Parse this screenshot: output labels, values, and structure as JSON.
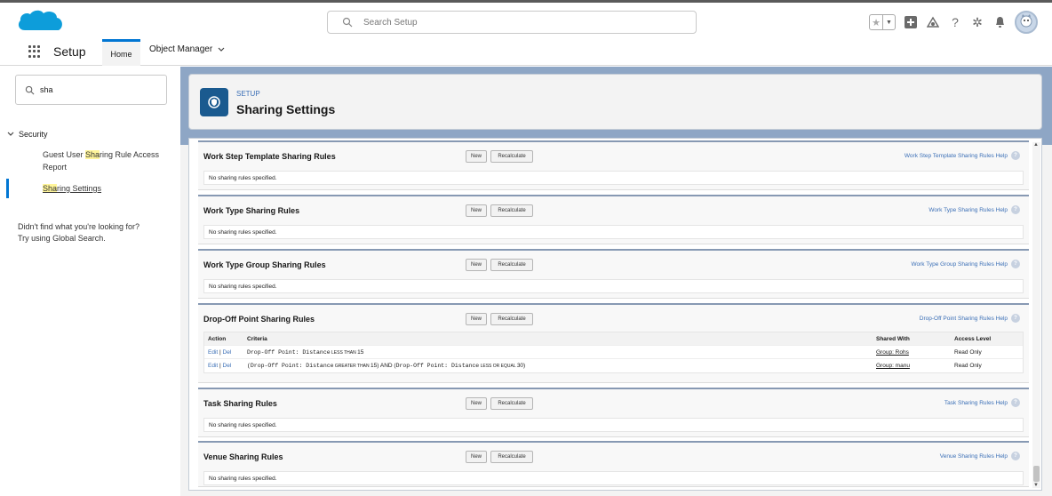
{
  "search": {
    "placeholder": "Search Setup"
  },
  "nav": {
    "app_name": "Setup",
    "tab_home": "Home",
    "tab_object_manager": "Object Manager"
  },
  "sidebar": {
    "quick_find_value": "sha",
    "section": "Security",
    "item1_pre": "Guest User ",
    "item1_hl": "Sha",
    "item1_post": "ring Rule Access Report",
    "item2_hl": "Sha",
    "item2_post": "ring Settings",
    "help_line1": "Didn't find what you're looking for?",
    "help_line2": "Try using Global Search."
  },
  "header": {
    "subtitle": "SETUP",
    "title": "Sharing Settings"
  },
  "buttons": {
    "new": "New",
    "recalculate": "Recalculate"
  },
  "empty_text": "No sharing rules specified.",
  "rules": [
    {
      "title": "Work Step Template Sharing Rules",
      "help": "Work Step Template Sharing Rules Help"
    },
    {
      "title": "Work Type Sharing Rules",
      "help": "Work Type Sharing Rules Help"
    },
    {
      "title": "Work Type Group Sharing Rules",
      "help": "Work Type Group Sharing Rules Help"
    },
    {
      "title": "Drop-Off Point Sharing Rules",
      "help": "Drop-Off Point Sharing Rules Help"
    },
    {
      "title": "Task Sharing Rules",
      "help": "Task Sharing Rules Help"
    },
    {
      "title": "Venue Sharing Rules",
      "help": "Venue Sharing Rules Help"
    }
  ],
  "dropoff_table": {
    "headers": {
      "action": "Action",
      "criteria": "Criteria",
      "shared_with": "Shared With",
      "access_level": "Access Level"
    },
    "rows": [
      {
        "edit": "Edit",
        "sep": " | ",
        "del": "Del",
        "criteria_parts": [
          "Drop-Off Point: Distance",
          " LESS THAN ",
          "15"
        ],
        "shared_with": "Group: Rohs",
        "access_level": "Read Only"
      },
      {
        "edit": "Edit",
        "sep": " | ",
        "del": "Del",
        "criteria_parts": [
          "(Drop-Off Point: Distance",
          " GREATER THAN ",
          "15) AND (",
          "Drop-Off Point: Distance",
          " LESS OR EQUAL ",
          "30)"
        ],
        "shared_with": "Group: manu",
        "access_level": "Read Only"
      }
    ]
  },
  "help_q": "?"
}
